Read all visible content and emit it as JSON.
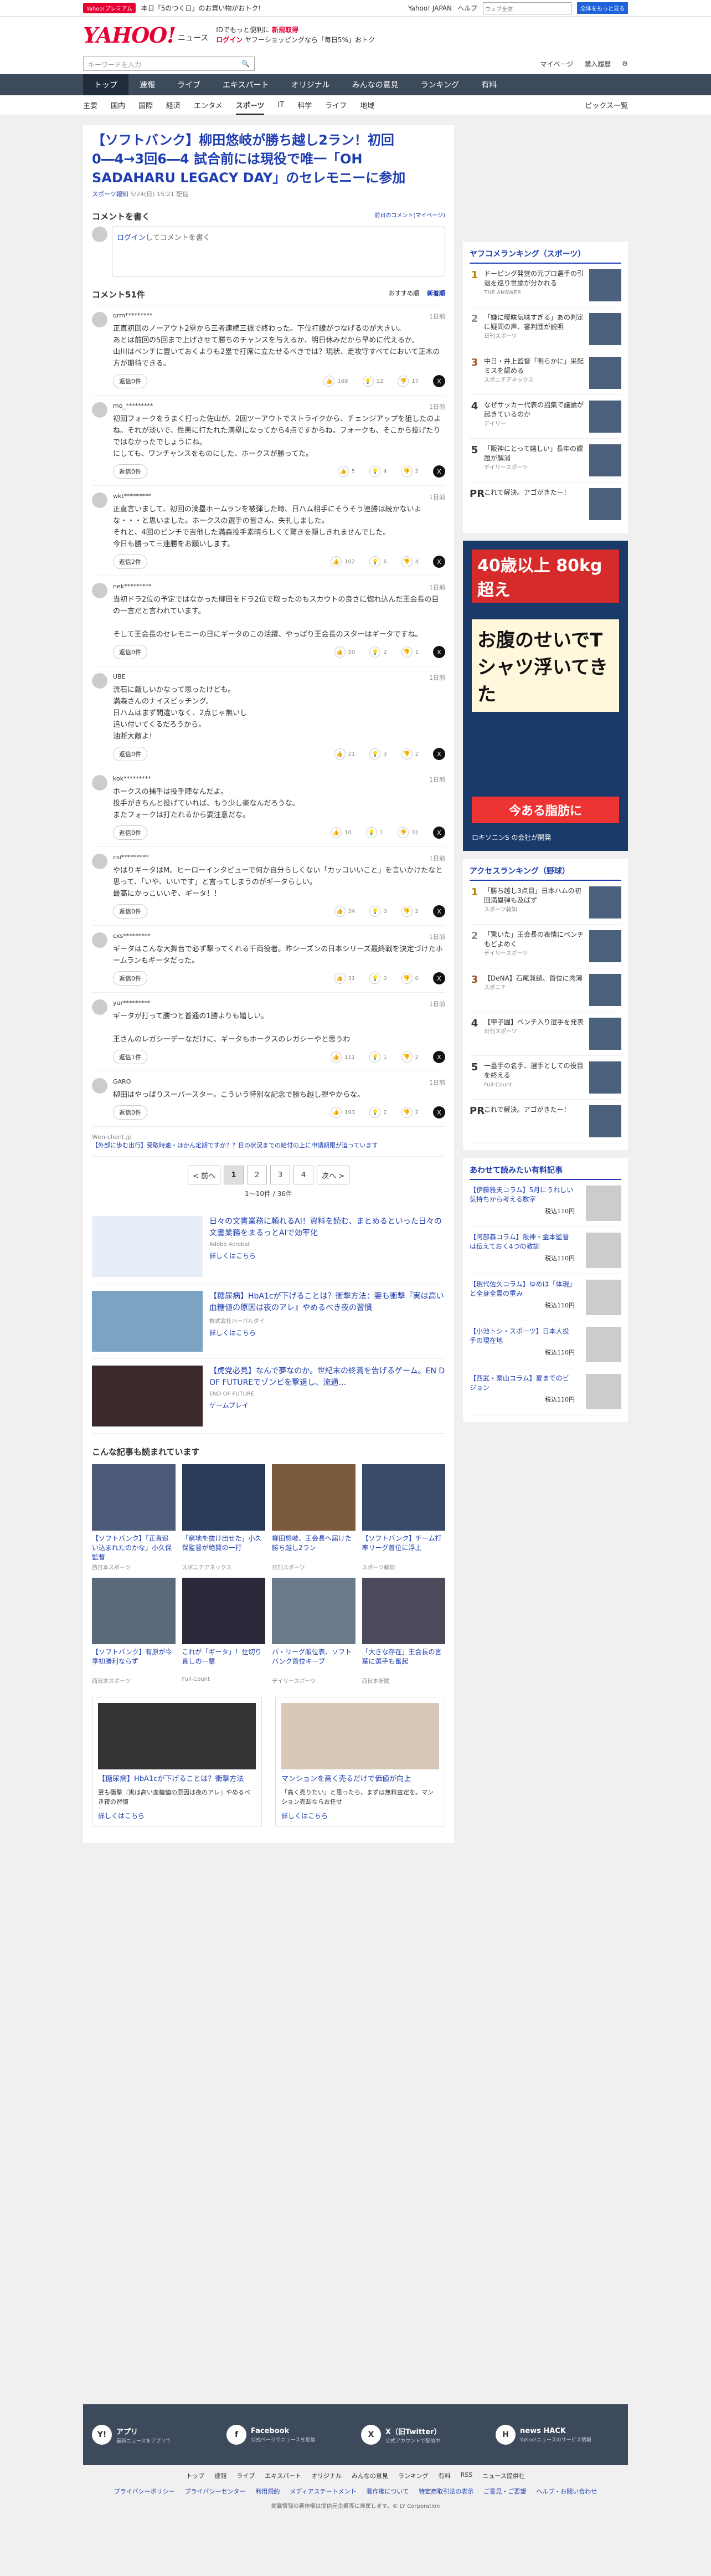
{
  "topbar": {
    "premium": "Yahoo!プレミアム",
    "promo": "本日「5のつく日」のお買い物がおトク!",
    "links": [
      "Yahoo! JAPAN",
      "ヘルプ"
    ],
    "search_placeholder": "ウェブ全体",
    "search_btn": "全体をもっと見る"
  },
  "header": {
    "logo": "YAHOO!",
    "logo_sub": "ニュース",
    "promo1": "IDでもっと便利に",
    "promo1b": "新規取得",
    "promo2": "ログイン",
    "promo3": "ヤフーショッピングなら「毎日5%」おトク"
  },
  "search": {
    "placeholder": "キーワードを入力",
    "mypage": "マイページ",
    "ad_settings": "購入履歴"
  },
  "gnav": [
    "トップ",
    "速報",
    "ライブ",
    "エキスパート",
    "オリジナル",
    "みんなの意見",
    "ランキング",
    "有料"
  ],
  "subnav": [
    "主要",
    "国内",
    "国際",
    "経済",
    "エンタメ",
    "スポーツ",
    "IT",
    "科学",
    "ライフ",
    "地域"
  ],
  "subnav_more": "ピックス一覧",
  "article": {
    "title": "【ソフトバンク】柳田悠岐が勝ち越し2ラン！初回0―4→3回6―4 試合前には現役で唯一「OH SADAHARU LEGACY DAY」のセレモニーに参加",
    "source": "スポーツ報知",
    "date": "5/24(日) 15:21 配信"
  },
  "comment_write": {
    "title": "コメントを書く",
    "policy": "前日のコメント(マイページ)",
    "login": "ログイン",
    "placeholder": "してコメントを書く"
  },
  "comments_head": {
    "title": "コメント51件",
    "sort1": "おすすめ順",
    "sort2": "新着順"
  },
  "comments": [
    {
      "user": "qrm*********",
      "time": "1日前",
      "text": "正直初回のノーアウト2塁から三者連続三振で終わった。下位打線がつなげるのが大きい。\nあとは前回の5回まで上げさせて勝ちのチャンスを与えるか、明日休みだから早めに代えるか。\n山川はベンチに置いておくよりも2塁で打席に立たせるべきでは？現状、走攻守すべてにおいて正木の方が期待できる。",
      "reply": "返信0件",
      "v1": "168",
      "v2": "12",
      "v3": "17"
    },
    {
      "user": "mo_*********",
      "time": "1日前",
      "text": "初回フォークをうまく打った佐山が、2回ツーアウトでストライクから、チェンジアップを狙したのよね。それが淡いで、性悪に打たれた満塁になってから4点ですからね。フォークも、そこから投げたりではなかったでしょうにね。\nにしても、ワンチャンスをものにした、ホークスが勝ってた。",
      "reply": "返信0件",
      "v1": "5",
      "v2": "4",
      "v3": "2"
    },
    {
      "user": "wkt*********",
      "time": "1日前",
      "text": "正直言いまして、初回の満塁ホームランを被弾した時、日ハム相手にそうそう連勝は続かないよな・・・と思いました。ホークスの選手の皆さん、失礼しました。\nそれと、4回のピンチで吉他した満森投手素晴らしくて驚きを隠しきれませんでした。\n今日も勝って三連勝をお願いします。",
      "reply": "返信2件",
      "v1": "102",
      "v2": "6",
      "v3": "4"
    },
    {
      "user": "nek*********",
      "time": "1日前",
      "text": "当初ドラ2位の予定ではなかった柳田をドラ2位で取ったのもスカウトの良さに惚れ込んだ王会長の目の一言だと言われています。\n\nそして王会長のセレモニーの日にギータのこの活躍、やっぱり王会長のスターはギータですね。",
      "reply": "返信0件",
      "v1": "50",
      "v2": "2",
      "v3": "1"
    },
    {
      "user": "UBE",
      "time": "1日前",
      "text": "流石に厳しいかなって思ったけども。\n満森さんのナイスピッチング。\n日ハムはまず間違いなく、2点じゃ無いし\n追い付いてくるだろうから。\n油断大敵よ！",
      "reply": "返信0件",
      "v1": "21",
      "v2": "3",
      "v3": "2"
    },
    {
      "user": "kok*********",
      "time": "1日前",
      "text": "ホークスの捕手は投手陣なんだよ。\n投手がきちんと投げていれば、もう少し楽なんだろうな。\nまたフォークは打たれるから要注意だな。",
      "reply": "返信0件",
      "v1": "10",
      "v2": "1",
      "v3": "31"
    },
    {
      "user": "csi*********",
      "time": "1日前",
      "text": "やはりギータはM。ヒーローインタビューで何か自分らしくない「カッコいいこと」を言いかけたなと思って、「いや、いいです」と言ってしまうのがギータらしい。\n最高にかっこいいぞ、ギータ！！",
      "reply": "返信0件",
      "v1": "34",
      "v2": "0",
      "v3": "2"
    },
    {
      "user": "cxs*********",
      "time": "1日前",
      "text": "ギータはこんな大舞台で必ず撃ってくれる千両役者。昨シーズンの日本シリーズ最終戦を決定づけたホームランもギータだった。",
      "reply": "返信0件",
      "v1": "31",
      "v2": "0",
      "v3": "0"
    },
    {
      "user": "yur*********",
      "time": "1日前",
      "text": "ギータが打って勝つと普通の1勝よりも嬉しい。\n\n王さんのレガシーデーなだけに、ギータもホークスのレガシーやと思うわ",
      "reply": "返信1件",
      "v1": "111",
      "v2": "1",
      "v3": "2"
    },
    {
      "user": "GARO",
      "time": "1日前",
      "text": "柳田はやっぱりスーパースター。こういう特別な記念で勝ち越し弾やからな。",
      "reply": "返信0件",
      "v1": "193",
      "v2": "2",
      "v3": "2"
    }
  ],
  "mini_ad": {
    "label": "Wen-client.jp",
    "text": "【外部に歩む出行】受取時速・ほかん定期ですか？？日の状況までの給付の上に申請期限が迫っています"
  },
  "pager": {
    "prev": "< 前へ",
    "pages": [
      "1",
      "2",
      "3",
      "4"
    ],
    "next": "次へ >",
    "count": "1〜10件 / 36件"
  },
  "ads": [
    {
      "title": "日々の文書業務に頼れるAI！資料を読む、まとめるといった日々の文書業務をまるっとAIで効率化",
      "sponsor": "Adobe Acrobat",
      "more": "詳しくはこちら"
    },
    {
      "title": "【糖尿病】HbA1cが下げることは？衝撃方法：妻も衝撃『実は高い血糖値の原因は夜のアレ』やめるべき夜の習慣",
      "sponsor": "株式会社ハーバルダイ",
      "more": "詳しくはこちら"
    },
    {
      "title": "【虎党必見】なんで夢なのか。世紀末の終焉を告げるゲーム。EN D OF FUTUREでゾンビを撃退し、流通…",
      "sponsor": "END OF FUTURE",
      "more": "ゲームプレイ"
    }
  ],
  "recommend": {
    "title": "こんな記事も読まれています",
    "items": [
      {
        "t": "【ソフトバンク】「正直追い込まれたのかな」小久保監督",
        "s": "西日本スポーツ"
      },
      {
        "t": "「窮地を抜け出せた」小久保監督が絶賛の一打",
        "s": "スポニチアネックス"
      },
      {
        "t": "柳田悠岐、王会長へ届けた勝ち越し2ラン",
        "s": "日刊スポーツ"
      },
      {
        "t": "【ソフトバンク】チーム打率リーグ首位に浮上",
        "s": "スポーツ報知"
      },
      {
        "t": "【ソフトバンク】有原が今季初勝利ならず",
        "s": "西日本スポーツ"
      },
      {
        "t": "これが「ギータ」！仕切り直しの一撃",
        "s": "Full-Count"
      },
      {
        "t": "パ・リーグ順位表、ソフトバンク首位キープ",
        "s": "デイリースポーツ"
      },
      {
        "t": "「大きな存在」王会長の言葉に選手も奮起",
        "s": "西日本新聞"
      }
    ]
  },
  "big_ads": [
    {
      "title": "【糖尿病】HbA1cが下げることは？衝撃方法",
      "desc": "妻も衝撃『実は高い血糖値の原因は夜のアレ』やめるべき夜の習慣",
      "more": "詳しくはこちら"
    },
    {
      "title": "マンションを高く売るだけで価値が向上",
      "desc": "「高く売りたい」と思ったら、まずは無料査定を。マンション売却ならお任せ",
      "more": "詳しくはこちら"
    }
  ],
  "side_rank": {
    "title": "ヤフコメランキング（スポーツ）",
    "items": [
      {
        "n": "1",
        "t": "ドーピング発覚の元プロ選手の引退を巡り世論が分かれる",
        "s": "THE ANSWER"
      },
      {
        "n": "2",
        "t": "「嫌に曖昧気味すぎる」あの判定に疑問の声、審判団が説明",
        "s": "日刊スポーツ"
      },
      {
        "n": "3",
        "t": "中日・井上監督「明らかに」采配ミスを認める",
        "s": "スポニチアネックス"
      },
      {
        "n": "4",
        "t": "なぜサッカー代表の招集で議論が起きているのか",
        "s": "デイリー"
      },
      {
        "n": "5",
        "t": "「阪神にとって嬉しい」長年の課題が解消",
        "s": "デイリースポーツ"
      }
    ],
    "pr": "これで解決。アゴがきたー！"
  },
  "side_ad": {
    "a1": "40歳以上 80kg超え",
    "a2": "お腹のせいでTシャツ浮いてきた",
    "a3": "今ある脂肪に",
    "a4": "ロキソニンS の会社が開発"
  },
  "side_rank2": {
    "title": "アクセスランキング（野球）",
    "items": [
      {
        "n": "1",
        "t": "「勝ち越し3点目」日本ハムの初回満塁弾も及ばず",
        "s": "スポーツ報知"
      },
      {
        "n": "2",
        "t": "「驚いた」王会長の表情にベンチもどよめく",
        "s": "デイリースポーツ"
      },
      {
        "n": "3",
        "t": "【DeNA】石尾兼続、首位に肉薄",
        "s": "スポニチ"
      },
      {
        "n": "4",
        "t": "【甲子園】ベンチ入り選手を発表",
        "s": "日刊スポーツ"
      },
      {
        "n": "5",
        "t": "一塁手の名手、選手としての役目を終える",
        "s": "Full-Count"
      }
    ],
    "pr": "これで解決。アゴがきたー！"
  },
  "side_products": {
    "title": "あわせて読みたい有料記事",
    "items": [
      {
        "t": "【伊藤雅夫コラム】5月にうれしい気持ちから考える数字",
        "p": "税込110円"
      },
      {
        "t": "【阿部森コラム】阪神・金本監督は伝えておく4つの教訓",
        "p": "税込110円"
      },
      {
        "t": "【現代佐久コラム】ゆめは「体現」と全身全霊の重み",
        "p": "税込110円"
      },
      {
        "t": "【小池トシ・スポーツ】日本人投手の現在地",
        "p": "税込110円"
      },
      {
        "t": "【西武・栗山コラム】夏までのビジョン",
        "p": "税込110円"
      }
    ]
  },
  "footer": {
    "items": [
      {
        "icon": "Y!",
        "title": "アプリ",
        "desc": "最新ニュースをアプリで"
      },
      {
        "icon": "f",
        "title": "Facebook",
        "desc": "公式ページでニュースを配信"
      },
      {
        "icon": "X",
        "title": "X（旧Twitter）",
        "desc": "公式アカウントで配信中"
      },
      {
        "icon": "H",
        "title": "news HACK",
        "desc": "Yahoo!ニュースのサービス情報"
      }
    ],
    "links1": [
      "トップ",
      "速報",
      "ライブ",
      "エキスパート",
      "オリジナル",
      "みんなの意見",
      "ランキング",
      "有料",
      "RSS",
      "ニュース提供社"
    ],
    "links2": [
      "プライバシーポリシー",
      "プライバシーセンター",
      "利用規約",
      "メディアステートメント",
      "著作権について",
      "特定商取引法の表示",
      "ご意見・ご要望",
      "ヘルプ・お問い合わせ"
    ],
    "copyright": "掲載情報の著作権は提供元企業等に帰属します。© LY Corporation"
  }
}
